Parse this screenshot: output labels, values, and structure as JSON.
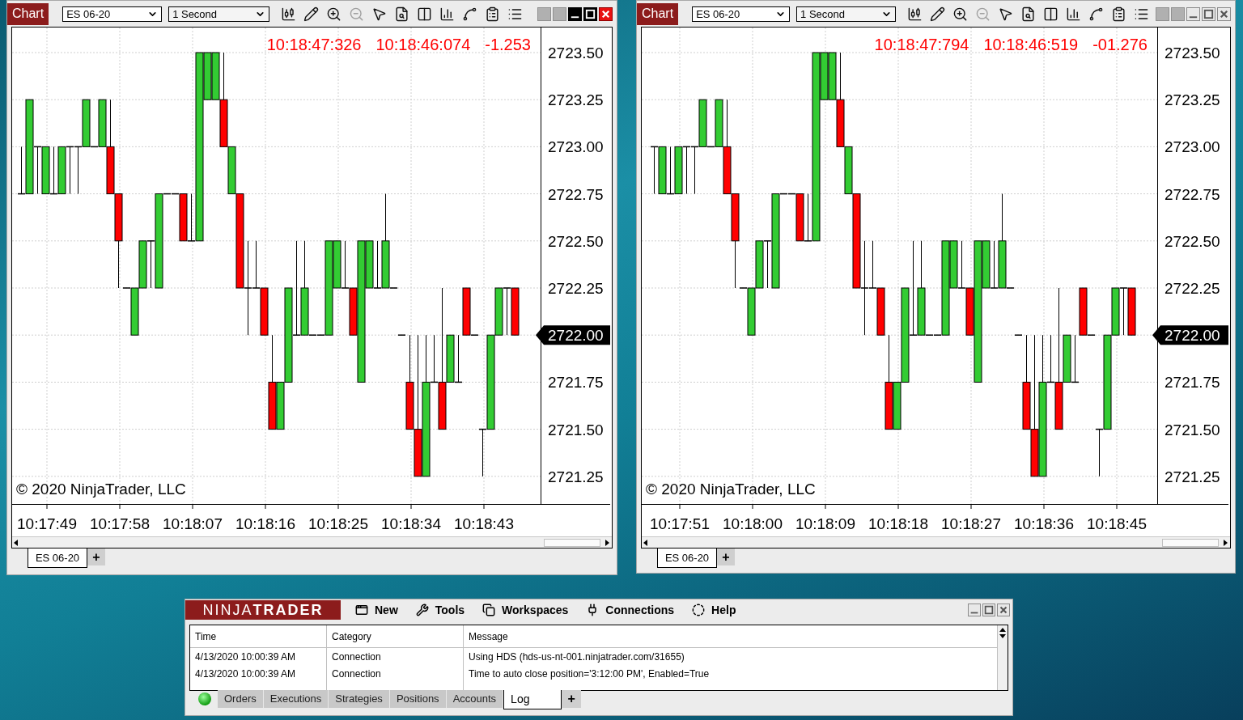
{
  "charts": [
    {
      "active": true,
      "badge": "Chart",
      "instrument": "ES 06-20",
      "interval": "1 Second",
      "info": [
        "10:18:47:326",
        "10:18:46:074",
        "-1.253"
      ],
      "y_ticks": [
        {
          "label": "2723.50",
          "highlighted": false
        },
        {
          "label": "2723.25",
          "highlighted": false
        },
        {
          "label": "2723.00",
          "highlighted": false
        },
        {
          "label": "2722.75",
          "highlighted": false
        },
        {
          "label": "2722.50",
          "highlighted": false
        },
        {
          "label": "2722.25",
          "highlighted": false
        },
        {
          "label": "2722.00",
          "highlighted": true
        },
        {
          "label": "2721.75",
          "highlighted": false
        },
        {
          "label": "2721.50",
          "highlighted": false
        },
        {
          "label": "2721.25",
          "highlighted": false
        }
      ],
      "x_ticks": [
        "10:17:49",
        "10:17:58",
        "10:18:07",
        "10:18:16",
        "10:18:25",
        "10:18:34",
        "10:18:43"
      ],
      "copyright": "© 2020 NinjaTrader, LLC",
      "tabs": [
        {
          "label": "ES 06-20",
          "selected": true
        }
      ],
      "add_tab": "+"
    },
    {
      "active": false,
      "badge": "Chart",
      "instrument": "ES 06-20",
      "interval": "1 Second",
      "info": [
        "10:18:47:794",
        "10:18:46:519",
        "-01.276"
      ],
      "y_ticks": [
        {
          "label": "2723.50",
          "highlighted": false
        },
        {
          "label": "2723.25",
          "highlighted": false
        },
        {
          "label": "2723.00",
          "highlighted": false
        },
        {
          "label": "2722.75",
          "highlighted": false
        },
        {
          "label": "2722.50",
          "highlighted": false
        },
        {
          "label": "2722.25",
          "highlighted": false
        },
        {
          "label": "2722.00",
          "highlighted": true
        },
        {
          "label": "2721.75",
          "highlighted": false
        },
        {
          "label": "2721.50",
          "highlighted": false
        },
        {
          "label": "2721.25",
          "highlighted": false
        }
      ],
      "x_ticks": [
        "10:17:51",
        "10:18:00",
        "10:18:09",
        "10:18:18",
        "10:18:27",
        "10:18:36",
        "10:18:45"
      ],
      "copyright": "© 2020 NinjaTrader, LLC",
      "tabs": [
        {
          "label": "ES 06-20",
          "selected": true
        }
      ],
      "add_tab": "+"
    }
  ],
  "control_center": {
    "logo": "NINJA**TRADER**",
    "menu": [
      {
        "label": "New"
      },
      {
        "label": "Tools"
      },
      {
        "label": "Workspaces"
      },
      {
        "label": "Connections"
      },
      {
        "label": "Help"
      }
    ],
    "log": {
      "columns": [
        "Time",
        "Category",
        "Message"
      ],
      "rows": [
        [
          "4/13/2020 10:00:39 AM",
          "Connection",
          "Using HDS (hds-us-nt-001.ninjatrader.com/31655)"
        ],
        [
          "4/13/2020 10:00:39 AM",
          "Connection",
          "Time to auto close position='3:12:00 PM', Enabled=True"
        ]
      ]
    },
    "connected": true,
    "tabs": [
      {
        "label": "Orders",
        "selected": false
      },
      {
        "label": "Executions",
        "selected": false
      },
      {
        "label": "Strategies",
        "selected": false
      },
      {
        "label": "Positions",
        "selected": false
      },
      {
        "label": "Accounts",
        "selected": false
      },
      {
        "label": "Log",
        "selected": true
      }
    ],
    "add_tab": "+"
  }
}
